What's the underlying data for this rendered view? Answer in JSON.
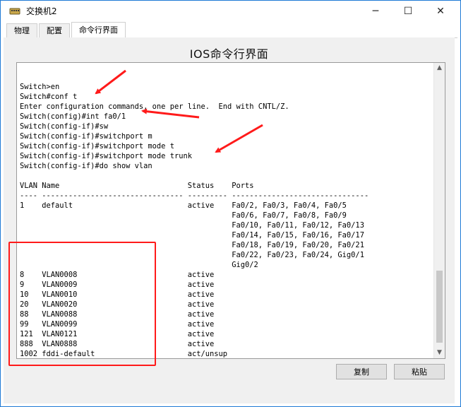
{
  "window": {
    "title": "交换机2",
    "controls": [
      "─",
      "☐",
      "✕"
    ]
  },
  "tabs": [
    {
      "label": "物理",
      "active": false
    },
    {
      "label": "配置",
      "active": false
    },
    {
      "label": "命令行界面",
      "active": true
    }
  ],
  "panel": {
    "title": "IOS命令行界面"
  },
  "console": {
    "lines": [
      "Switch>en",
      "Switch#conf t",
      "Enter configuration commands, one per line.  End with CNTL/Z.",
      "Switch(config)#int fa0/1",
      "Switch(config-if)#sw",
      "Switch(config-if)#switchport m",
      "Switch(config-if)#switchport mode t",
      "Switch(config-if)#switchport mode trunk",
      "Switch(config-if)#do show vlan",
      "",
      "VLAN Name                             Status    Ports",
      "---- -------------------------------- --------- -------------------------------",
      "1    default                          active    Fa0/2, Fa0/3, Fa0/4, Fa0/5",
      "                                                Fa0/6, Fa0/7, Fa0/8, Fa0/9",
      "                                                Fa0/10, Fa0/11, Fa0/12, Fa0/13",
      "                                                Fa0/14, Fa0/15, Fa0/16, Fa0/17",
      "                                                Fa0/18, Fa0/19, Fa0/20, Fa0/21",
      "                                                Fa0/22, Fa0/23, Fa0/24, Gig0/1",
      "                                                Gig0/2",
      "8    VLAN0008                         active",
      "9    VLAN0009                         active",
      "10   VLAN0010                         active",
      "20   VLAN0020                         active",
      "88   VLAN0088                         active",
      "99   VLAN0099                         active",
      "121  VLAN0121                         active",
      "888  VLAN0888                         active",
      "1002 fddi-default                     act/unsup"
    ]
  },
  "buttons": {
    "copy_label": "复制",
    "paste_label": "粘贴"
  },
  "annotation_colors": {
    "arrow": "#ff1a1a",
    "highlight_box": "#ff1a1a"
  }
}
